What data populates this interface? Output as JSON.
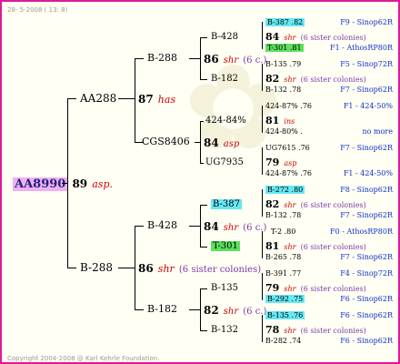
{
  "header": "28- 5-2008 ( 13: 8)",
  "copyright": "Copyright 2004-2008 @ Karl Kehrle Foundation.",
  "root": {
    "name": "AA8990",
    "num": "89",
    "race": "asp."
  },
  "gen1": {
    "top": {
      "name": "AA288",
      "num": "87",
      "race": "has"
    },
    "bottom": {
      "name": "B-288",
      "num": "86",
      "race": "shr",
      "note": "(6 sister colonies)"
    }
  },
  "gen2": {
    "a": {
      "name": "B-288",
      "num": "86",
      "race": "shr",
      "note": "(6 c.)"
    },
    "b": {
      "name": "CGS8406",
      "num": "84",
      "race": "asp"
    },
    "c": {
      "name": "B-428",
      "num": "84",
      "race": "shr",
      "note": "(6 c.)"
    },
    "d": {
      "name": "B-182",
      "num": "82",
      "race": "shr",
      "note": "(6 c.)"
    }
  },
  "gen3": [
    "B-428",
    "B-182",
    "424-84%",
    "UG7935",
    "B-387",
    "T-301",
    "B-135",
    "B-132"
  ],
  "gen4": [
    {
      "a": "B-387 .82",
      "num": "84",
      "race": "shr",
      "note": "(6 sister colonies)",
      "b": "T-301 .81",
      "s1": "F9 - Sinop62R",
      "s2": "F1 - AthosRP80R"
    },
    {
      "a": "B-135 .79",
      "num": "82",
      "race": "shr",
      "note": "(6 sister colonies)",
      "b": "B-132 .78",
      "s1": "F5 - Sinop72R",
      "s2": "F7 - Sinop62R"
    },
    {
      "a": "424-87% .76",
      "num": "81",
      "race": "ins",
      "note": "",
      "b": "424-80% .",
      "s1": "F1 - 424-50%",
      "s2": "no more"
    },
    {
      "a": "UG7615 .76",
      "num": "79",
      "race": "asp",
      "note": "",
      "b": "424-87% .76",
      "s1": "F7 - Sinop62R",
      "s2": "F1 - 424-50%"
    },
    {
      "a": "B-272 .80",
      "num": "82",
      "race": "shr",
      "note": "(6 sister colonies)",
      "b": "B-132 .78",
      "s1": "F8 - Sinop62R",
      "s2": "F7 - Sinop62R"
    },
    {
      "a": "T-2 .80",
      "num": "81",
      "race": "shr",
      "note": "(6 sister colonies)",
      "b": "B-265 .78",
      "s1": "F0 - AthosRP80R",
      "s2": "F7 - Sinop62R"
    },
    {
      "a": "B-391 .77",
      "num": "79",
      "race": "shr",
      "note": "(6 sister colonies)",
      "b": "B-292 .75",
      "s1": "F4 - Sinop72R",
      "s2": "F6 - Sinop62R"
    },
    {
      "a": "B-135 .76",
      "num": "78",
      "race": "shr",
      "note": "(6 sister colonies)",
      "b": "B-282 .74",
      "s1": "F6 - Sinop62R",
      "s2": "F6 - Sinop62R"
    }
  ]
}
